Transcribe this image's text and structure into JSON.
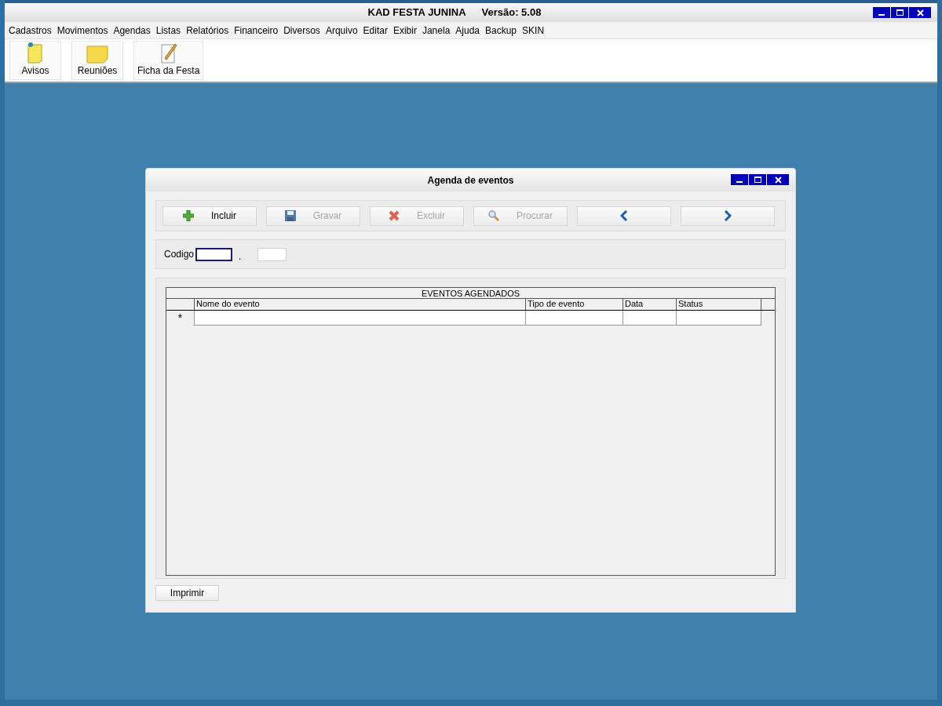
{
  "window": {
    "title": "KAD FESTA JUNINA",
    "version": "Versão: 5.08"
  },
  "menu": [
    "Cadastros",
    "Movimentos",
    "Agendas",
    "Listas",
    "Relatórios",
    "Financeiro",
    "Diversos",
    "Arquivo",
    "Editar",
    "Exibir",
    "Janela",
    "Ajuda",
    "Backup",
    "SKIN"
  ],
  "toolbar": [
    {
      "label": "Avisos",
      "kind": "note"
    },
    {
      "label": "Reuniões",
      "kind": "sticky"
    },
    {
      "label": "Ficha da Festa",
      "kind": "pencil"
    }
  ],
  "dialog": {
    "title": "Agenda de eventos",
    "buttons": [
      {
        "label": "Incluir",
        "kind": "plus",
        "disabled": false
      },
      {
        "label": "Gravar",
        "kind": "save",
        "disabled": true
      },
      {
        "label": "Excluir",
        "kind": "cross",
        "disabled": true
      },
      {
        "label": "Procurar",
        "kind": "search",
        "disabled": true
      },
      {
        "kind": "prev",
        "disabled": false
      },
      {
        "kind": "next",
        "disabled": false
      }
    ],
    "code_label": "Codigo",
    "separator": ".",
    "grid": {
      "title": "EVENTOS AGENDADOS",
      "columns": [
        "Nome do evento",
        "Tipo de evento",
        "Data",
        "Status"
      ],
      "new_row_marker": "*"
    },
    "print_button": "Imprimir"
  }
}
